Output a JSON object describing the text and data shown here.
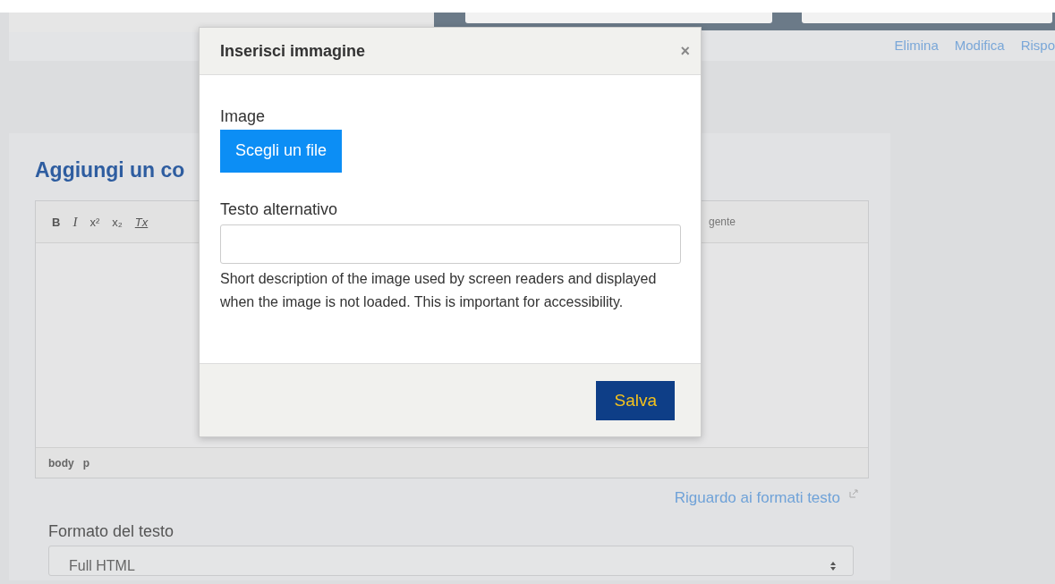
{
  "header": {
    "links": [
      "Elimina",
      "Modifica",
      "Rispo"
    ]
  },
  "form": {
    "title": "Aggiungi un co",
    "toolbar": [
      {
        "label": "B",
        "kind": "bold"
      },
      {
        "label": "I",
        "kind": "italic"
      },
      {
        "label": "x²",
        "kind": "plain"
      },
      {
        "label": "x₂",
        "kind": "plain"
      },
      {
        "label": "Tx",
        "kind": "clear"
      }
    ],
    "toolbar_right": "gente",
    "path": [
      "body",
      "p"
    ],
    "help_link": "Riguardo ai formati testo",
    "format_label": "Formato del testo",
    "format_value": "Full HTML"
  },
  "modal": {
    "title": "Inserisci immagine",
    "close": "×",
    "image_label": "Image",
    "file_button": "Scegli un file",
    "alt_label": "Testo alternativo",
    "alt_help": "Short description of the image used by screen readers and displayed when the image is not loaded. This is important for accessibility.",
    "save": "Salva"
  }
}
